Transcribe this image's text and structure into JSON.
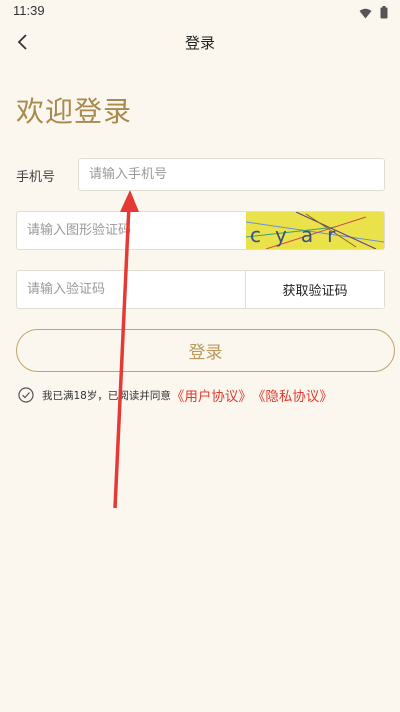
{
  "status_bar": {
    "time": "11:39",
    "wifi_icon": "wifi-icon",
    "battery_icon": "battery-icon"
  },
  "nav": {
    "title": "登录",
    "back_icon": "chevron-left-icon"
  },
  "welcome_title": "欢迎登录",
  "phone": {
    "label": "手机号",
    "placeholder": "请输入手机号",
    "value": ""
  },
  "captcha": {
    "placeholder": "请输入图形验证码",
    "value": "",
    "image_text": "cyar"
  },
  "sms": {
    "placeholder": "请输入验证码",
    "value": "",
    "button_label": "获取验证码"
  },
  "login_button": "登录",
  "agreement": {
    "text": "我已满18岁，已阅读并同意",
    "user_agreement": "《用户协议》",
    "privacy_policy": "《隐私协议》",
    "checked": false
  },
  "colors": {
    "background": "#fbf7ef",
    "accent": "#a98a4e",
    "link": "#e23a2e",
    "annotation_arrow": "#e53935"
  }
}
